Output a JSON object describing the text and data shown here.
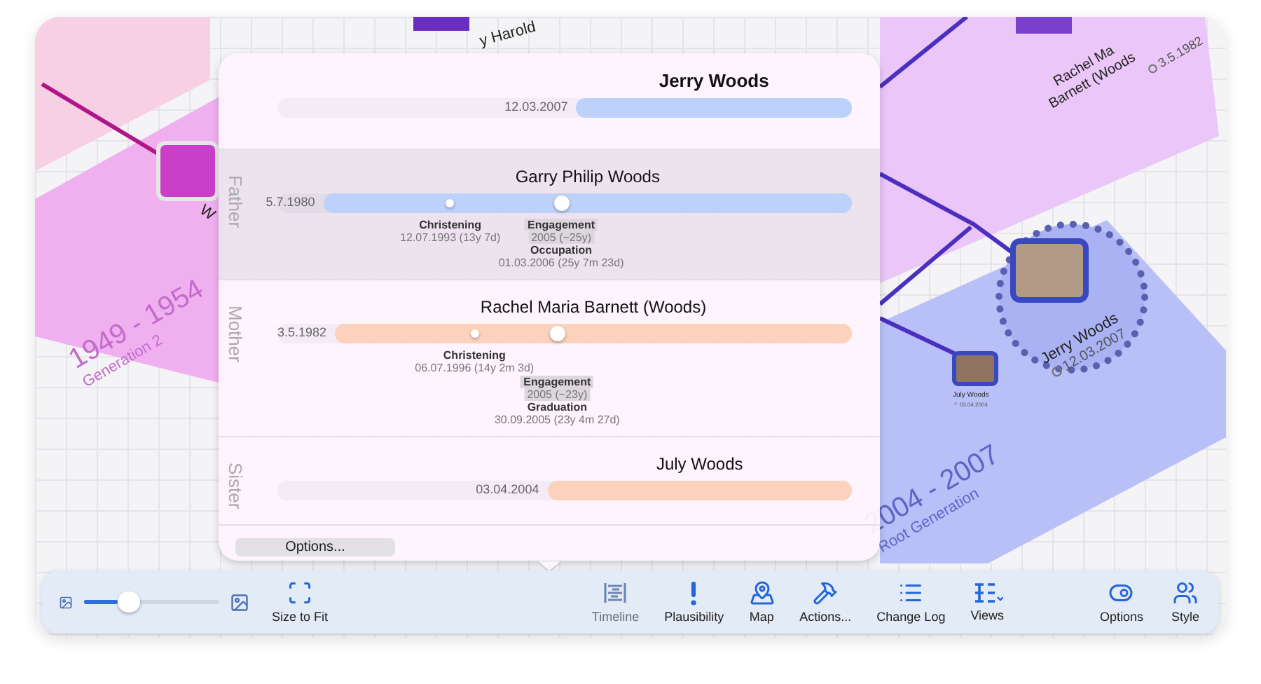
{
  "canvas": {
    "generations": [
      {
        "kind": "pink",
        "years": "1949 - 1954",
        "caption": "Generation 2"
      },
      {
        "kind": "blue",
        "years": "2004 - 2007",
        "caption": "Root Generation"
      }
    ],
    "nodes": [
      {
        "kind": "small-top",
        "lines": [
          "y Harold"
        ]
      },
      {
        "kind": "left",
        "lines": [
          "W"
        ]
      },
      {
        "kind": "top-right",
        "lines": [
          "Rachel Ma",
          "Barnett (Woods"
        ],
        "date": "3.5.1982"
      },
      {
        "kind": "root",
        "lines": [
          "Jerry Woods"
        ],
        "date": "12.03.2007"
      },
      {
        "kind": "child",
        "lines": [
          "July Woods"
        ],
        "date": "03.04.2004"
      }
    ]
  },
  "popover": {
    "people": [
      {
        "name": "Jerry Woods",
        "start": "12.03.2007",
        "level": 0.48,
        "color": "#bcd2fb",
        "shaded": false
      },
      {
        "relation": "Father",
        "name": "Garry Philip Woods",
        "start": "5.7.1980",
        "level": 0.92,
        "color": "#bcd2fb",
        "shaded": true,
        "clusters": [
          {
            "kind": "small",
            "level": 0.24,
            "events": [
              {
                "title": "Christening",
                "date": "12.07.1993 (13y 7d)",
                "approximate": false
              }
            ]
          },
          {
            "kind": "large",
            "level": 0.45,
            "events": [
              {
                "title": "Engagement",
                "date": "2005 (~25y)",
                "approximate": true
              },
              {
                "title": "Occupation",
                "date": "01.03.2006 (25y 7m 23d)",
                "approximate": false
              }
            ]
          }
        ]
      },
      {
        "relation": "Mother",
        "name": "Rachel Maria Barnett (Woods)",
        "start": "3.5.1982",
        "level": 0.9,
        "color": "#fbd3bc",
        "shaded": false,
        "clusters": [
          {
            "kind": "small",
            "level": 0.27,
            "events": [
              {
                "title": "Christening",
                "date": "06.07.1996 (14y 2m 3d)",
                "approximate": false
              }
            ]
          },
          {
            "kind": "large",
            "level": 0.43,
            "events": [
              {
                "title": "Engagement",
                "date": "2005 (~23y)",
                "approximate": true
              },
              {
                "title": "Graduation",
                "date": "30.09.2005 (23y 4m 27d)",
                "approximate": false
              }
            ]
          }
        ]
      },
      {
        "relation": "Sister",
        "name": "July Woods",
        "start": "03.04.2004",
        "level": 0.53,
        "color": "#fbd3bc",
        "shaded": false
      }
    ],
    "options_button": "Options..."
  },
  "toolbar": {
    "zoom": {
      "level": 0.33
    },
    "items": [
      {
        "kind": "fit",
        "label": "Size to Fit",
        "selected": false
      },
      {
        "kind": "timeline",
        "label": "Timeline",
        "selected": true
      },
      {
        "kind": "plausibility",
        "label": "Plausibility",
        "selected": false
      },
      {
        "kind": "map",
        "label": "Map",
        "selected": false
      },
      {
        "kind": "actions",
        "label": "Actions...",
        "selected": false
      },
      {
        "kind": "log",
        "label": "Change Log",
        "selected": false
      },
      {
        "kind": "views",
        "label": "Views",
        "selected": false
      },
      {
        "kind": "options",
        "label": "Options",
        "selected": false
      },
      {
        "kind": "style",
        "label": "Style",
        "selected": false
      }
    ]
  }
}
